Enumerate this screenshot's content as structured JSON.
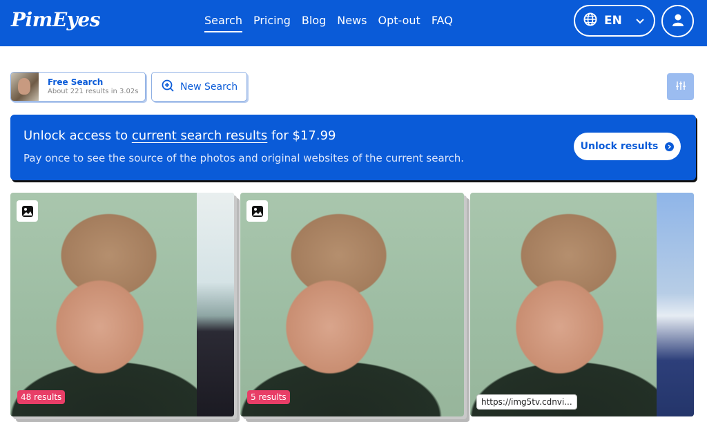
{
  "header": {
    "logo": "PimEyes",
    "nav": [
      "Search",
      "Pricing",
      "Blog",
      "News",
      "Opt-out",
      "FAQ"
    ],
    "active_nav": "Search",
    "language": "EN"
  },
  "toolbar": {
    "free_search_title": "Free Search",
    "free_search_subtitle": "About 221 results in 3.02s",
    "new_search_label": "New Search"
  },
  "banner": {
    "title_prefix": "Unlock access to ",
    "title_link": "current search results",
    "title_suffix": " for $17.99",
    "subtitle": "Pay once to see the source of the photos and original websites of the current search.",
    "button_label": "Unlock results"
  },
  "results": [
    {
      "badge": "48 results"
    },
    {
      "badge": "5 results"
    },
    {
      "url": "https://img5tv.cdnvi..."
    }
  ],
  "colors": {
    "brand_blue": "#0a5bd8",
    "badge_pink": "#e83e67"
  }
}
